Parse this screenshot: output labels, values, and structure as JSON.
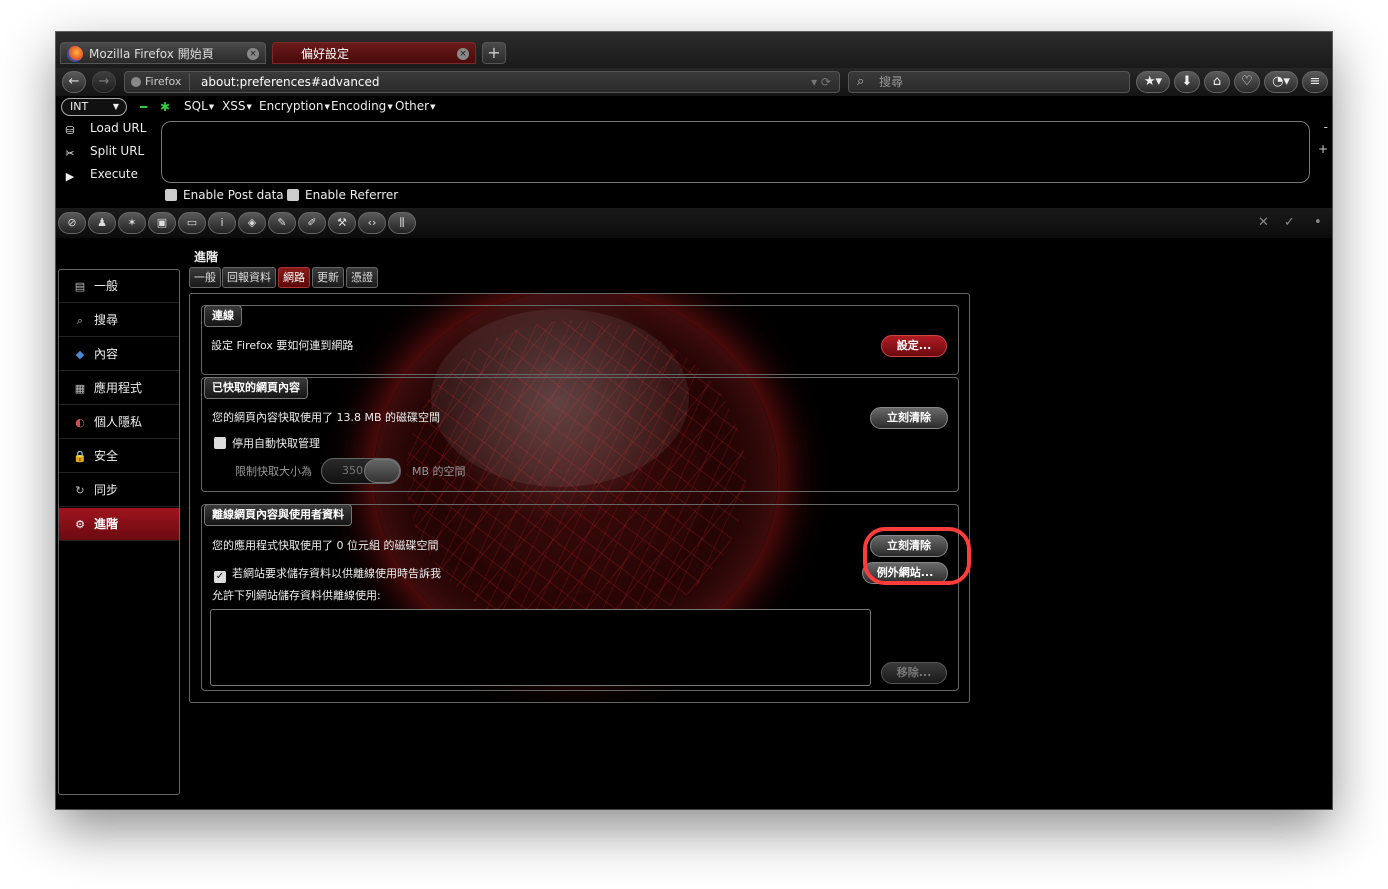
{
  "tabs": [
    {
      "title": "Mozilla Firefox 開始頁",
      "active": false
    },
    {
      "title": "偏好設定",
      "active": true
    }
  ],
  "new_tab_symbol": "+",
  "nav": {
    "identity_label": "Firefox",
    "url": "about:preferences#advanced",
    "url_end_glyphs": "▾ ⟳",
    "search_placeholder": "搜尋"
  },
  "hackbar": {
    "select_value": "INT",
    "menus": [
      {
        "label": "SQL"
      },
      {
        "label": "XSS"
      },
      {
        "label": "Encryption"
      },
      {
        "label": "Encoding"
      },
      {
        "label": "Other"
      }
    ],
    "actions": [
      {
        "label": "Load URL",
        "icon": "load-url-icon"
      },
      {
        "label": "Split URL",
        "icon": "split-url-icon"
      },
      {
        "label": "Execute",
        "icon": "execute-icon"
      }
    ],
    "url_text": "",
    "minus": "-",
    "plus": "+",
    "checkboxes": [
      {
        "label": "Enable Post data",
        "checked": false
      },
      {
        "label": "Enable Referrer",
        "checked": false
      }
    ]
  },
  "iconbar_right": {
    "close": "✕",
    "check": "✓",
    "dot": "•"
  },
  "prefs": {
    "page_title": "進階",
    "categories": [
      {
        "label": "一般",
        "icon": "general-icon",
        "glyph": "▤"
      },
      {
        "label": "搜尋",
        "icon": "search-icon",
        "glyph": "⌕"
      },
      {
        "label": "內容",
        "icon": "content-icon",
        "glyph": "◆"
      },
      {
        "label": "應用程式",
        "icon": "applications-icon",
        "glyph": "▦"
      },
      {
        "label": "個人隱私",
        "icon": "privacy-icon",
        "glyph": "◐"
      },
      {
        "label": "安全",
        "icon": "security-icon",
        "glyph": "🔒"
      },
      {
        "label": "同步",
        "icon": "sync-icon",
        "glyph": "↻"
      },
      {
        "label": "進階",
        "icon": "advanced-icon",
        "glyph": "⚙",
        "selected": true
      }
    ],
    "subtabs": [
      {
        "label": "一般"
      },
      {
        "label": "回報資料"
      },
      {
        "label": "網路",
        "selected": true
      },
      {
        "label": "更新"
      },
      {
        "label": "憑證"
      }
    ],
    "connection": {
      "caption": "連線",
      "text": "設定 Firefox 要如何連到網路",
      "button": "設定..."
    },
    "cache": {
      "caption": "已快取的網頁內容",
      "usage_text": "您的網頁內容快取使用了 13.8 MB 的磁碟空間",
      "clear_button": "立刻清除",
      "override_label": "停用自動快取管理",
      "override_checked": false,
      "limit_label": "限制快取大小為",
      "limit_value": "350",
      "limit_unit": "MB 的空間"
    },
    "offline": {
      "caption": "離線網頁內容與使用者資料",
      "usage_text": "您的應用程式快取使用了 0 位元組 的磁碟空間",
      "clear_button": "立刻清除",
      "notify_label": "若網站要求儲存資料以供離線使用時告訴我",
      "notify_checked": true,
      "exceptions_button": "例外網站...",
      "allowed_label": "允許下列網站儲存資料供離線使用:",
      "remove_button": "移除..."
    }
  },
  "colors": {
    "accent_red": "#a0141e",
    "highlight_ring": "#ff3b3b",
    "hackbar_green": "#2ecc40"
  }
}
